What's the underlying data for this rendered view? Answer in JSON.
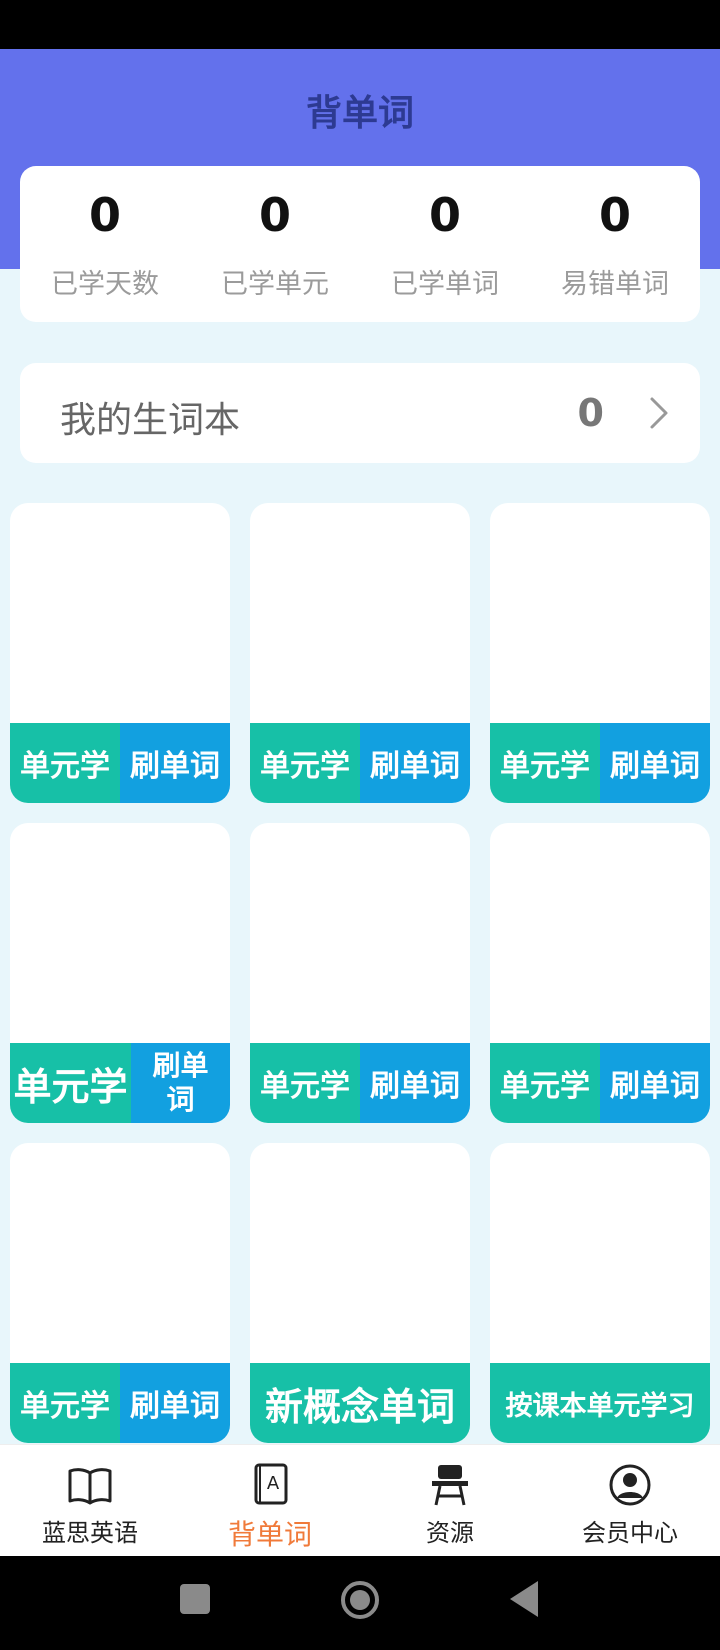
{
  "header": {
    "title": "背单词"
  },
  "stats": [
    {
      "value": "0",
      "label": "已学天数"
    },
    {
      "value": "0",
      "label": "已学单元"
    },
    {
      "value": "0",
      "label": "已学单词"
    },
    {
      "value": "0",
      "label": "易错单词"
    }
  ],
  "vocab_book": {
    "label": "我的生词本",
    "count": "0"
  },
  "cards": [
    {
      "buttons": [
        "单元学",
        "刷单词"
      ]
    },
    {
      "buttons": [
        "单元学",
        "刷单词"
      ]
    },
    {
      "buttons": [
        "单元学",
        "刷单词"
      ]
    },
    {
      "buttons": [
        "单元学",
        "刷单词"
      ]
    },
    {
      "buttons": [
        "单元学",
        "刷单词"
      ]
    },
    {
      "buttons": [
        "单元学",
        "刷单词"
      ]
    },
    {
      "buttons": [
        "单元学",
        "刷单词"
      ]
    },
    {
      "buttons": [
        "新概念单词"
      ]
    },
    {
      "buttons": [
        "按课本单元学习"
      ]
    }
  ],
  "tabbar": [
    {
      "label": "蓝思英语",
      "icon": "book-icon",
      "active": false
    },
    {
      "label": "背单词",
      "icon": "word-book-icon",
      "active": true
    },
    {
      "label": "资源",
      "icon": "desk-icon",
      "active": false
    },
    {
      "label": "会员中心",
      "icon": "user-icon",
      "active": false
    }
  ],
  "colors": {
    "header": "#6371ec",
    "teal": "#17c0a7",
    "blue": "#12a0e0",
    "active_tab": "#f07a3a"
  }
}
